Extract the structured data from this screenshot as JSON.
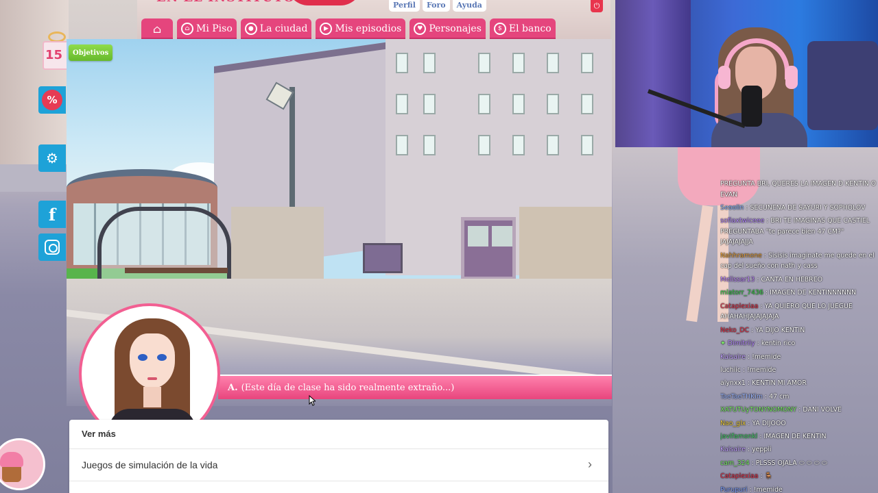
{
  "topbar": {
    "brand_text": "EN EL INSTITUTO",
    "links": [
      "Perfil",
      "Foro",
      "Ayuda"
    ],
    "power_icon": "power-icon",
    "nav": [
      {
        "label": "",
        "icon": "home-icon"
      },
      {
        "label": "Mi Piso",
        "icon": "home-circle-icon"
      },
      {
        "label": "La ciudad",
        "icon": "pin-icon"
      },
      {
        "label": "Mis episodios",
        "icon": "play-icon"
      },
      {
        "label": "Personajes",
        "icon": "heart-icon"
      },
      {
        "label": "El banco",
        "icon": "bank-icon"
      }
    ]
  },
  "sidebar": {
    "gift_count": "15",
    "promo_symbol": "%",
    "facebook_symbol": "f"
  },
  "game": {
    "objectives_label": "Objetivos",
    "dialogue_speaker": "A.",
    "dialogue_text": "(Este día de clase ha sido realmente extraño...)"
  },
  "ver_mas": {
    "title": "Ver más",
    "items": [
      "Juegos de simulación de la vida"
    ]
  },
  "chat": {
    "messages": [
      {
        "user": "",
        "user_color": "#ffffff",
        "text": "PREGUNTA BRI, QUERES LA IMAGEN D KENTIN O EVAN",
        "wrap": true
      },
      {
        "user": "Seoolin",
        "user_color": "#8fb4ff",
        "text": "SECUNENA DE SAYURI Y SOPHOLOV"
      },
      {
        "user": "sofiaxtwiceee",
        "user_color": "#b78cff",
        "text": "BRI TE IMAGINAS QUE CASTIEL PREGUNTABA \"te parece bien 47 CM?\" JAJAJAJAJJA",
        "wrap": true
      },
      {
        "user": "Nahhramone",
        "user_color": "#e9a23b",
        "text": "Sisisis imaginate me quede en el cap del sueño con nath y cass",
        "wrap": true
      },
      {
        "user": "Melissar13",
        "user_color": "#c08cff",
        "text": "CANTA EN HEBREO"
      },
      {
        "user": "mlatorr_7436",
        "user_color": "#3fd04f",
        "text": "IMAGEN DE KENTINNNNNN"
      },
      {
        "user": "Cataplexiaa",
        "user_color": "#e0344b",
        "text": "YA QUIERO QUE LO JUEGUE AHAHAHJAJAJAJAJA",
        "wrap": true
      },
      {
        "user": "Neko_DC",
        "user_color": "#e0344b",
        "text": "YA DIJO KENTIN"
      },
      {
        "user": "Dimitriiy",
        "user_color": "#b88cff",
        "text": "kentin rico",
        "badge": "✦"
      },
      {
        "user": "Kalsaire",
        "user_color": "#c3a3ff",
        "text": "!memide"
      },
      {
        "user": "luchiic",
        "user_color": "#ffffff",
        "text": "!memide"
      },
      {
        "user": "alynxx1",
        "user_color": "#ffffff",
        "text": "KENTIN MI AMOR"
      },
      {
        "user": "TaeTaeTHKim",
        "user_color": "#9fb8ff",
        "text": "47 cm"
      },
      {
        "user": "XATUTUyTONYNOMONY",
        "user_color": "#7ef06a",
        "text": "DANI VOLVE"
      },
      {
        "user": "Nao_glx",
        "user_color": "#f3d23e",
        "text": "YA DIJOOO"
      },
      {
        "user": "javifamonkl",
        "user_color": "#47d36c",
        "text": "IMAGEN DE KENTIN"
      },
      {
        "user": "Kalsaire",
        "user_color": "#c3a3ff",
        "text": "yeppii"
      },
      {
        "user": "cam_324",
        "user_color": "#7ef06a",
        "text": "PLSSS OJALA ⬭ ⬭ ⬭ ⬭"
      },
      {
        "user": "Cataplexiaa",
        "user_color": "#e0344b",
        "text": "🪑"
      },
      {
        "user": "Purupuri",
        "user_color": "#7fa0ff",
        "text": "!memide"
      }
    ]
  },
  "colors": {
    "nav_pink": "#e5457d",
    "accent_blue": "#1ea2d8",
    "objectives_green": "#7ac83a"
  }
}
